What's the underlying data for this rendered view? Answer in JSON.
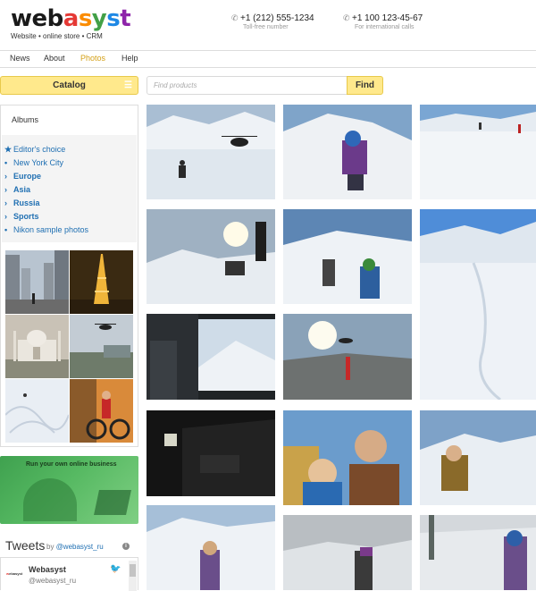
{
  "header": {
    "logo": [
      "web",
      "a",
      "s",
      "y",
      "s",
      "t"
    ],
    "tagline": "Website • online store • CRM",
    "phone1": {
      "number": "+1 (212) 555-1234",
      "note": "Toll-free number"
    },
    "phone2": {
      "number": "+1 100 123-45-67",
      "note": "For international calls"
    }
  },
  "nav": {
    "items": [
      "News",
      "About",
      "Photos",
      "Help"
    ],
    "active": "Photos"
  },
  "catalog": {
    "label": "Catalog"
  },
  "search": {
    "placeholder": "Find products",
    "button": "Find"
  },
  "sidebar": {
    "title": "Albums",
    "albums": [
      {
        "label": "Editor's choice",
        "marker": "star"
      },
      {
        "label": "New York City",
        "marker": "dot"
      },
      {
        "label": "Europe",
        "marker": "arrow"
      },
      {
        "label": "Asia",
        "marker": "arrow"
      },
      {
        "label": "Russia",
        "marker": "arrow"
      },
      {
        "label": "Sports",
        "marker": "arrow"
      },
      {
        "label": "Nikon sample photos",
        "marker": "dot"
      }
    ]
  },
  "banner": {
    "text": "Run your own online business"
  },
  "tweets": {
    "title": "Tweets",
    "by_prefix": "by",
    "by_handle": "@webasyst_ru",
    "author": "Webasyst",
    "handle": "@webasyst_ru"
  },
  "colors": {
    "logo": [
      "#1a1a1a",
      "#e53935",
      "#fb8c00",
      "#43a047",
      "#1e88e5",
      "#8e24aa"
    ],
    "accent": "#ffe98c",
    "link": "#1f6fb2",
    "active_nav": "#d4a017"
  }
}
